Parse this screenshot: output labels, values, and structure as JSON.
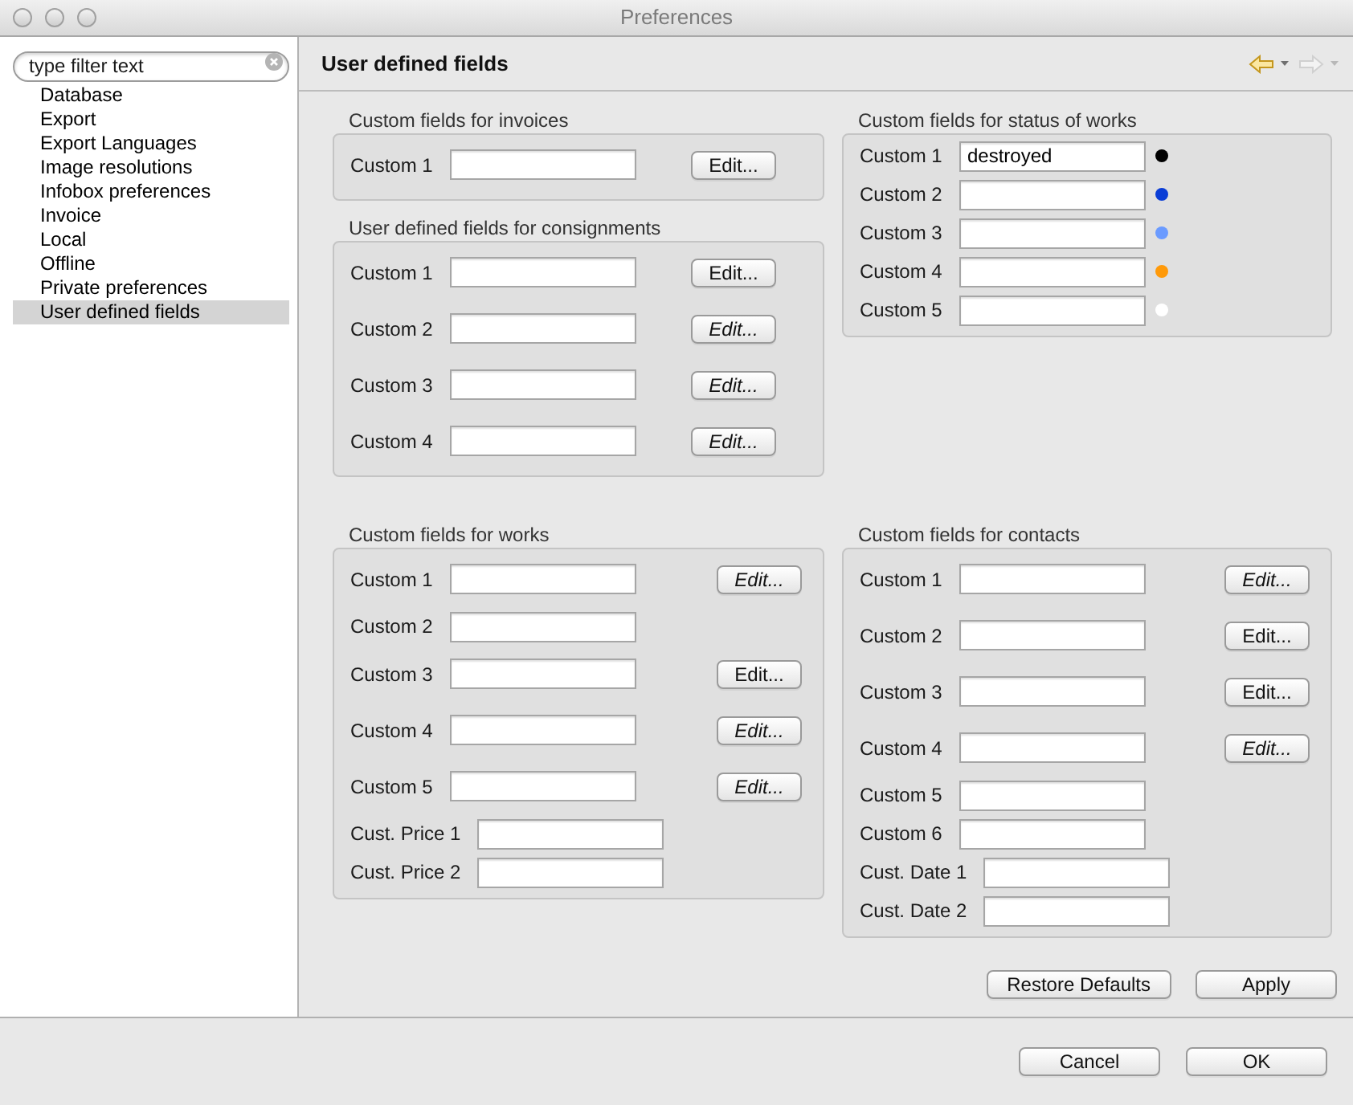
{
  "window": {
    "title": "Preferences"
  },
  "sidebar": {
    "filter": {
      "placeholder": "type filter text"
    },
    "items": [
      {
        "label": "Database",
        "selected": false
      },
      {
        "label": "Export",
        "selected": false
      },
      {
        "label": "Export Languages",
        "selected": false
      },
      {
        "label": "Image resolutions",
        "selected": false
      },
      {
        "label": "Infobox preferences",
        "selected": false
      },
      {
        "label": "Invoice",
        "selected": false
      },
      {
        "label": "Local",
        "selected": false
      },
      {
        "label": "Offline",
        "selected": false
      },
      {
        "label": "Private preferences",
        "selected": false
      },
      {
        "label": "User defined fields",
        "selected": true
      }
    ]
  },
  "page": {
    "title": "User defined fields",
    "navigation": [
      {
        "kind": "back",
        "disabled": false
      },
      {
        "kind": "forward",
        "disabled": true
      }
    ]
  },
  "groups": [
    {
      "title": "Custom fields for invoices",
      "rows": [
        {
          "kind": "edit",
          "label": "Custom 1",
          "button": {
            "label": "Edit...",
            "italic": false
          }
        }
      ]
    },
    {
      "title": "Custom fields for status of works",
      "rows": [
        {
          "kind": "status",
          "label": "Custom 1",
          "value": "destroyed",
          "color": "#000000"
        },
        {
          "kind": "status",
          "label": "Custom 2",
          "color": "#0a3dd6"
        },
        {
          "kind": "status",
          "label": "Custom 3",
          "color": "#6b9bff"
        },
        {
          "kind": "status",
          "label": "Custom 4",
          "color": "#ff9a0a"
        },
        {
          "kind": "status",
          "label": "Custom 5",
          "color": "#ffffff"
        }
      ]
    },
    {
      "title": "User defined fields for consignments",
      "rows": [
        {
          "kind": "edit",
          "label": "Custom 1",
          "button": {
            "label": "Edit...",
            "italic": false
          }
        },
        {
          "kind": "edit",
          "label": "Custom 2",
          "button": {
            "label": "Edit...",
            "italic": true
          }
        },
        {
          "kind": "edit",
          "label": "Custom 3",
          "button": {
            "label": "Edit...",
            "italic": true
          }
        },
        {
          "kind": "edit",
          "label": "Custom 4",
          "button": {
            "label": "Edit...",
            "italic": true
          }
        }
      ]
    },
    {
      "title": "Custom fields for works",
      "rows": [
        {
          "kind": "edit",
          "label": "Custom 1",
          "button": {
            "label": "Edit...",
            "italic": true
          }
        },
        {
          "kind": "field",
          "label": "Custom 2"
        },
        {
          "kind": "edit",
          "label": "Custom 3",
          "button": {
            "label": "Edit...",
            "italic": false
          }
        },
        {
          "kind": "edit",
          "label": "Custom 4",
          "button": {
            "label": "Edit...",
            "italic": true
          }
        },
        {
          "kind": "edit",
          "label": "Custom 5",
          "button": {
            "label": "Edit...",
            "italic": true
          }
        },
        {
          "kind": "field",
          "label": "Cust. Price 1"
        },
        {
          "kind": "field",
          "label": "Cust. Price 2"
        }
      ]
    },
    {
      "title": "Custom fields for contacts",
      "rows": [
        {
          "kind": "edit",
          "label": "Custom 1",
          "button": {
            "label": "Edit...",
            "italic": true
          }
        },
        {
          "kind": "edit",
          "label": "Custom 2",
          "button": {
            "label": "Edit...",
            "italic": false
          }
        },
        {
          "kind": "edit",
          "label": "Custom 3",
          "button": {
            "label": "Edit...",
            "italic": false
          }
        },
        {
          "kind": "edit",
          "label": "Custom 4",
          "button": {
            "label": "Edit...",
            "italic": true
          }
        },
        {
          "kind": "field",
          "label": "Custom 5"
        },
        {
          "kind": "field",
          "label": "Custom 6"
        },
        {
          "kind": "field",
          "label": "Cust. Date 1"
        },
        {
          "kind": "field",
          "label": "Cust. Date 2"
        }
      ]
    }
  ],
  "page_buttons": [
    {
      "label": "Restore Defaults"
    },
    {
      "label": "Apply"
    }
  ],
  "dialog_buttons": [
    {
      "label": "Cancel"
    },
    {
      "label": "OK"
    }
  ]
}
